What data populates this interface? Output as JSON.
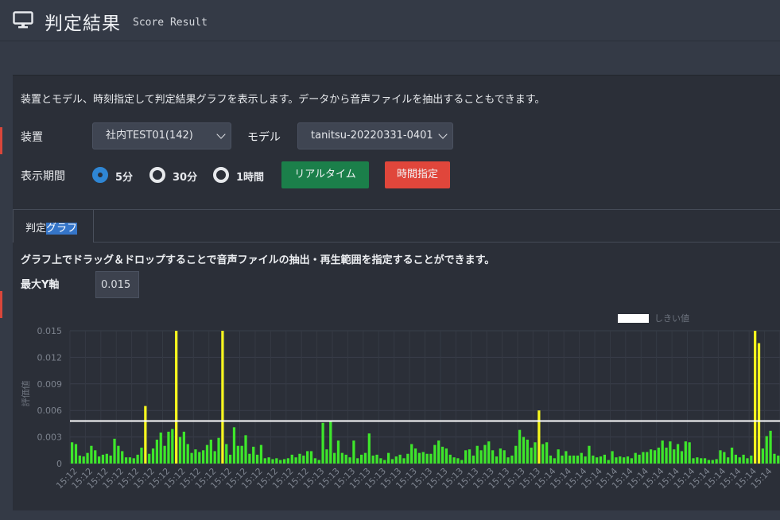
{
  "header": {
    "title": "判定結果",
    "subtitle": "Score Result"
  },
  "description": "装置とモデル、時刻指定して判定結果グラフを表示します。データから音声ファイルを抽出することもできます。",
  "form": {
    "device_label": "装置",
    "device_value": "社内TEST01(142)",
    "model_label": "モデル",
    "model_value": "tanitsu-20220331-0401",
    "period_label": "表示期間",
    "period_options": [
      "5分",
      "30分",
      "1時間"
    ],
    "period_selected": "5分",
    "realtime_button": "リアルタイム",
    "time_button": "時間指定"
  },
  "tabs": {
    "graph_tab_prefix": "判定",
    "graph_tab_highlight": "グラフ"
  },
  "graph": {
    "description": "グラフ上でドラッグ＆ドロップすることで音声ファイルの抽出・再生範囲を指定することができます。",
    "ymax_label": "最大Y軸",
    "ymax_value": "0.015"
  },
  "colors": {
    "normal_bar": "#3ee62b",
    "exceed_bar": "#f6f61e",
    "threshold_line": "#ffffff",
    "realtime_button": "#1b7f4a",
    "time_button": "#e0463b",
    "radio_selected": "#2f86d4"
  },
  "chart_data": {
    "type": "bar",
    "ylabel": "評価値",
    "ylim": [
      0,
      0.015
    ],
    "yticks": [
      "0",
      "0.003",
      "0.006",
      "0.009",
      "0.012",
      "0.015"
    ],
    "legend": [
      {
        "name": "しきい値",
        "position": "top-right"
      }
    ],
    "threshold": 0.0048,
    "grid": true,
    "x_tick_labels": [
      "15:12",
      "15:12",
      "15:12",
      "15:12",
      "15:12",
      "15:12",
      "15:12",
      "15:12",
      "15:12",
      "15:12",
      "15:12",
      "15:12",
      "15:12",
      "15:12",
      "15:12",
      "15:12",
      "15:13",
      "15:13",
      "15:13",
      "15:13",
      "15:13",
      "15:13",
      "15:13",
      "15:13",
      "15:13",
      "15:13",
      "15:13",
      "15:13",
      "15:13",
      "15:13",
      "15:13",
      "15:14",
      "15:14",
      "15:14",
      "15:14",
      "15:14",
      "15:14",
      "15:14",
      "15:14",
      "15:14",
      "15:14",
      "15:14",
      "15:14",
      "15:14",
      "15:14",
      "15:14"
    ],
    "values": [
      0.0024,
      0.0022,
      0.0009,
      0.0008,
      0.0012,
      0.002,
      0.0015,
      0.0008,
      0.001,
      0.0011,
      0.0009,
      0.0028,
      0.002,
      0.0014,
      0.0007,
      0.0007,
      0.0006,
      0.001,
      0.0018,
      0.0065,
      0.0011,
      0.0017,
      0.0027,
      0.0035,
      0.002,
      0.0036,
      0.0039,
      0.015,
      0.003,
      0.0036,
      0.0022,
      0.0012,
      0.0016,
      0.0013,
      0.0015,
      0.0021,
      0.0027,
      0.0014,
      0.0029,
      0.015,
      0.0022,
      0.001,
      0.0041,
      0.002,
      0.002,
      0.0032,
      0.0011,
      0.0019,
      0.001,
      0.0021,
      0.0006,
      0.0007,
      0.0005,
      0.0006,
      0.0004,
      0.0005,
      0.0006,
      0.001,
      0.0007,
      0.0011,
      0.0009,
      0.0014,
      0.0014,
      0.0006,
      0.0004,
      0.0046,
      0.0016,
      0.0048,
      0.0012,
      0.0026,
      0.0012,
      0.001,
      0.0007,
      0.0026,
      0.0006,
      0.001,
      0.0012,
      0.0034,
      0.0009,
      0.001,
      0.0006,
      0.0004,
      0.0012,
      0.0005,
      0.0008,
      0.001,
      0.0006,
      0.0011,
      0.0022,
      0.0017,
      0.0012,
      0.0013,
      0.0011,
      0.0011,
      0.0021,
      0.0026,
      0.0019,
      0.0017,
      0.001,
      0.0007,
      0.0006,
      0.0004,
      0.0015,
      0.0016,
      0.0009,
      0.002,
      0.0015,
      0.0021,
      0.0025,
      0.0015,
      0.0008,
      0.0017,
      0.0015,
      0.0007,
      0.0009,
      0.002,
      0.0038,
      0.003,
      0.0027,
      0.0018,
      0.0024,
      0.006,
      0.0022,
      0.0024,
      0.0009,
      0.0006,
      0.0016,
      0.0009,
      0.0014,
      0.0009,
      0.0009,
      0.0009,
      0.0012,
      0.0008,
      0.002,
      0.0009,
      0.0007,
      0.0008,
      0.001,
      0.0004,
      0.0014,
      0.0007,
      0.0008,
      0.0007,
      0.0008,
      0.0006,
      0.0012,
      0.001,
      0.0013,
      0.0013,
      0.0016,
      0.0015,
      0.0018,
      0.0026,
      0.0018,
      0.0025,
      0.0016,
      0.0022,
      0.0014,
      0.0025,
      0.0024,
      0.0006,
      0.0007,
      0.0006,
      0.0006,
      0.0004,
      0.0004,
      0.0005,
      0.0015,
      0.0013,
      0.0007,
      0.0018,
      0.001,
      0.0007,
      0.001,
      0.0006,
      0.0009,
      0.015,
      0.0136,
      0.0017,
      0.0031,
      0.0037,
      0.0011,
      0.0009
    ]
  }
}
